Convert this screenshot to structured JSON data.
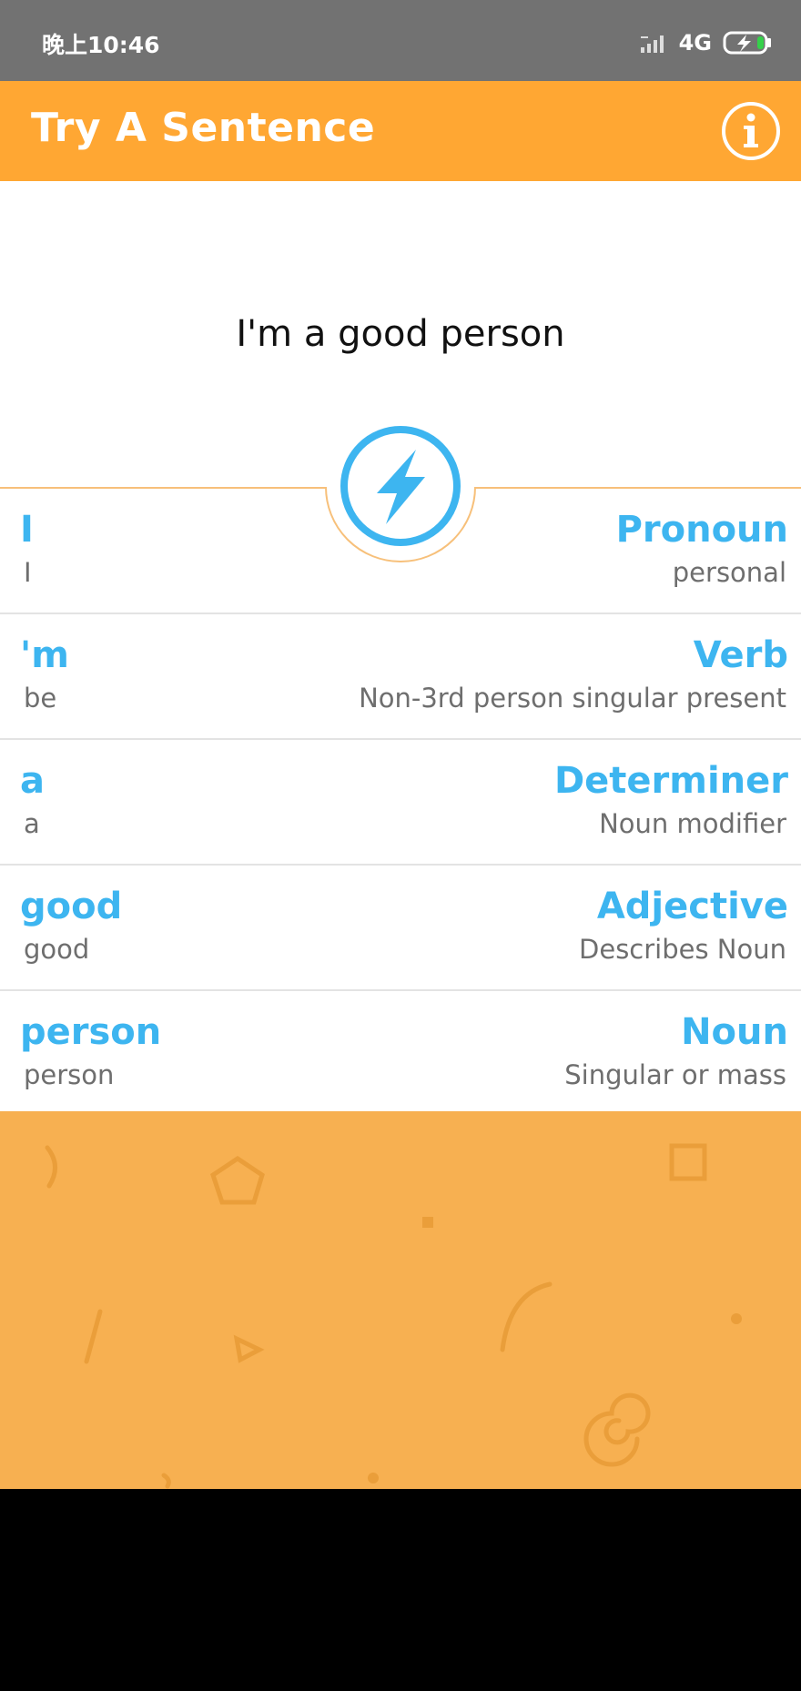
{
  "status": {
    "time": "晚上10:46",
    "network": "4G"
  },
  "header": {
    "title": "Try A Sentence"
  },
  "sentence": "I'm a good person",
  "tokens": [
    {
      "word": "I",
      "lemma": "I",
      "pos": "Pronoun",
      "desc": "personal"
    },
    {
      "word": "'m",
      "lemma": "be",
      "pos": "Verb",
      "desc": "Non-3rd person singular present"
    },
    {
      "word": "a",
      "lemma": "a",
      "pos": "Determiner",
      "desc": "Noun modifier"
    },
    {
      "word": "good",
      "lemma": "good",
      "pos": "Adjective",
      "desc": "Describes Noun"
    },
    {
      "word": "person",
      "lemma": "person",
      "pos": "Noun",
      "desc": "Singular or mass"
    }
  ],
  "colors": {
    "accent": "#ffa733",
    "word": "#3db5f0",
    "pattern": "#f7b051",
    "statusbar": "#727272"
  },
  "icons": [
    "signal-icon",
    "battery-charging-icon",
    "info-icon",
    "lightning-bolt-icon"
  ]
}
